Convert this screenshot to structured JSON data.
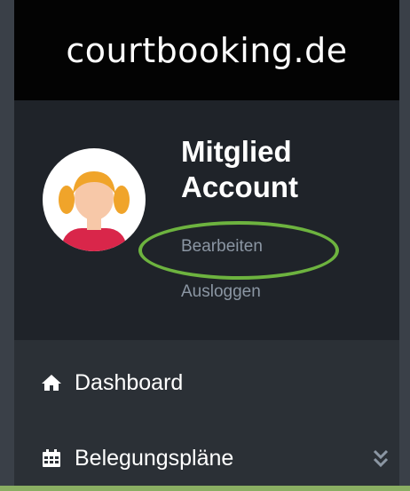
{
  "logo": {
    "text": "courtbooking.de"
  },
  "profile": {
    "name": "Mitglied\nAccount",
    "edit_label": "Bearbeiten",
    "logout_label": "Ausloggen"
  },
  "nav": {
    "items": [
      {
        "label": "Dashboard",
        "icon": "home-icon"
      },
      {
        "label": "Belegungspläne",
        "icon": "calendar-icon",
        "expand_icon": "double-chevron-down-icon"
      }
    ]
  },
  "colors": {
    "highlight": "#6db33f",
    "link": "#8b96a3"
  }
}
